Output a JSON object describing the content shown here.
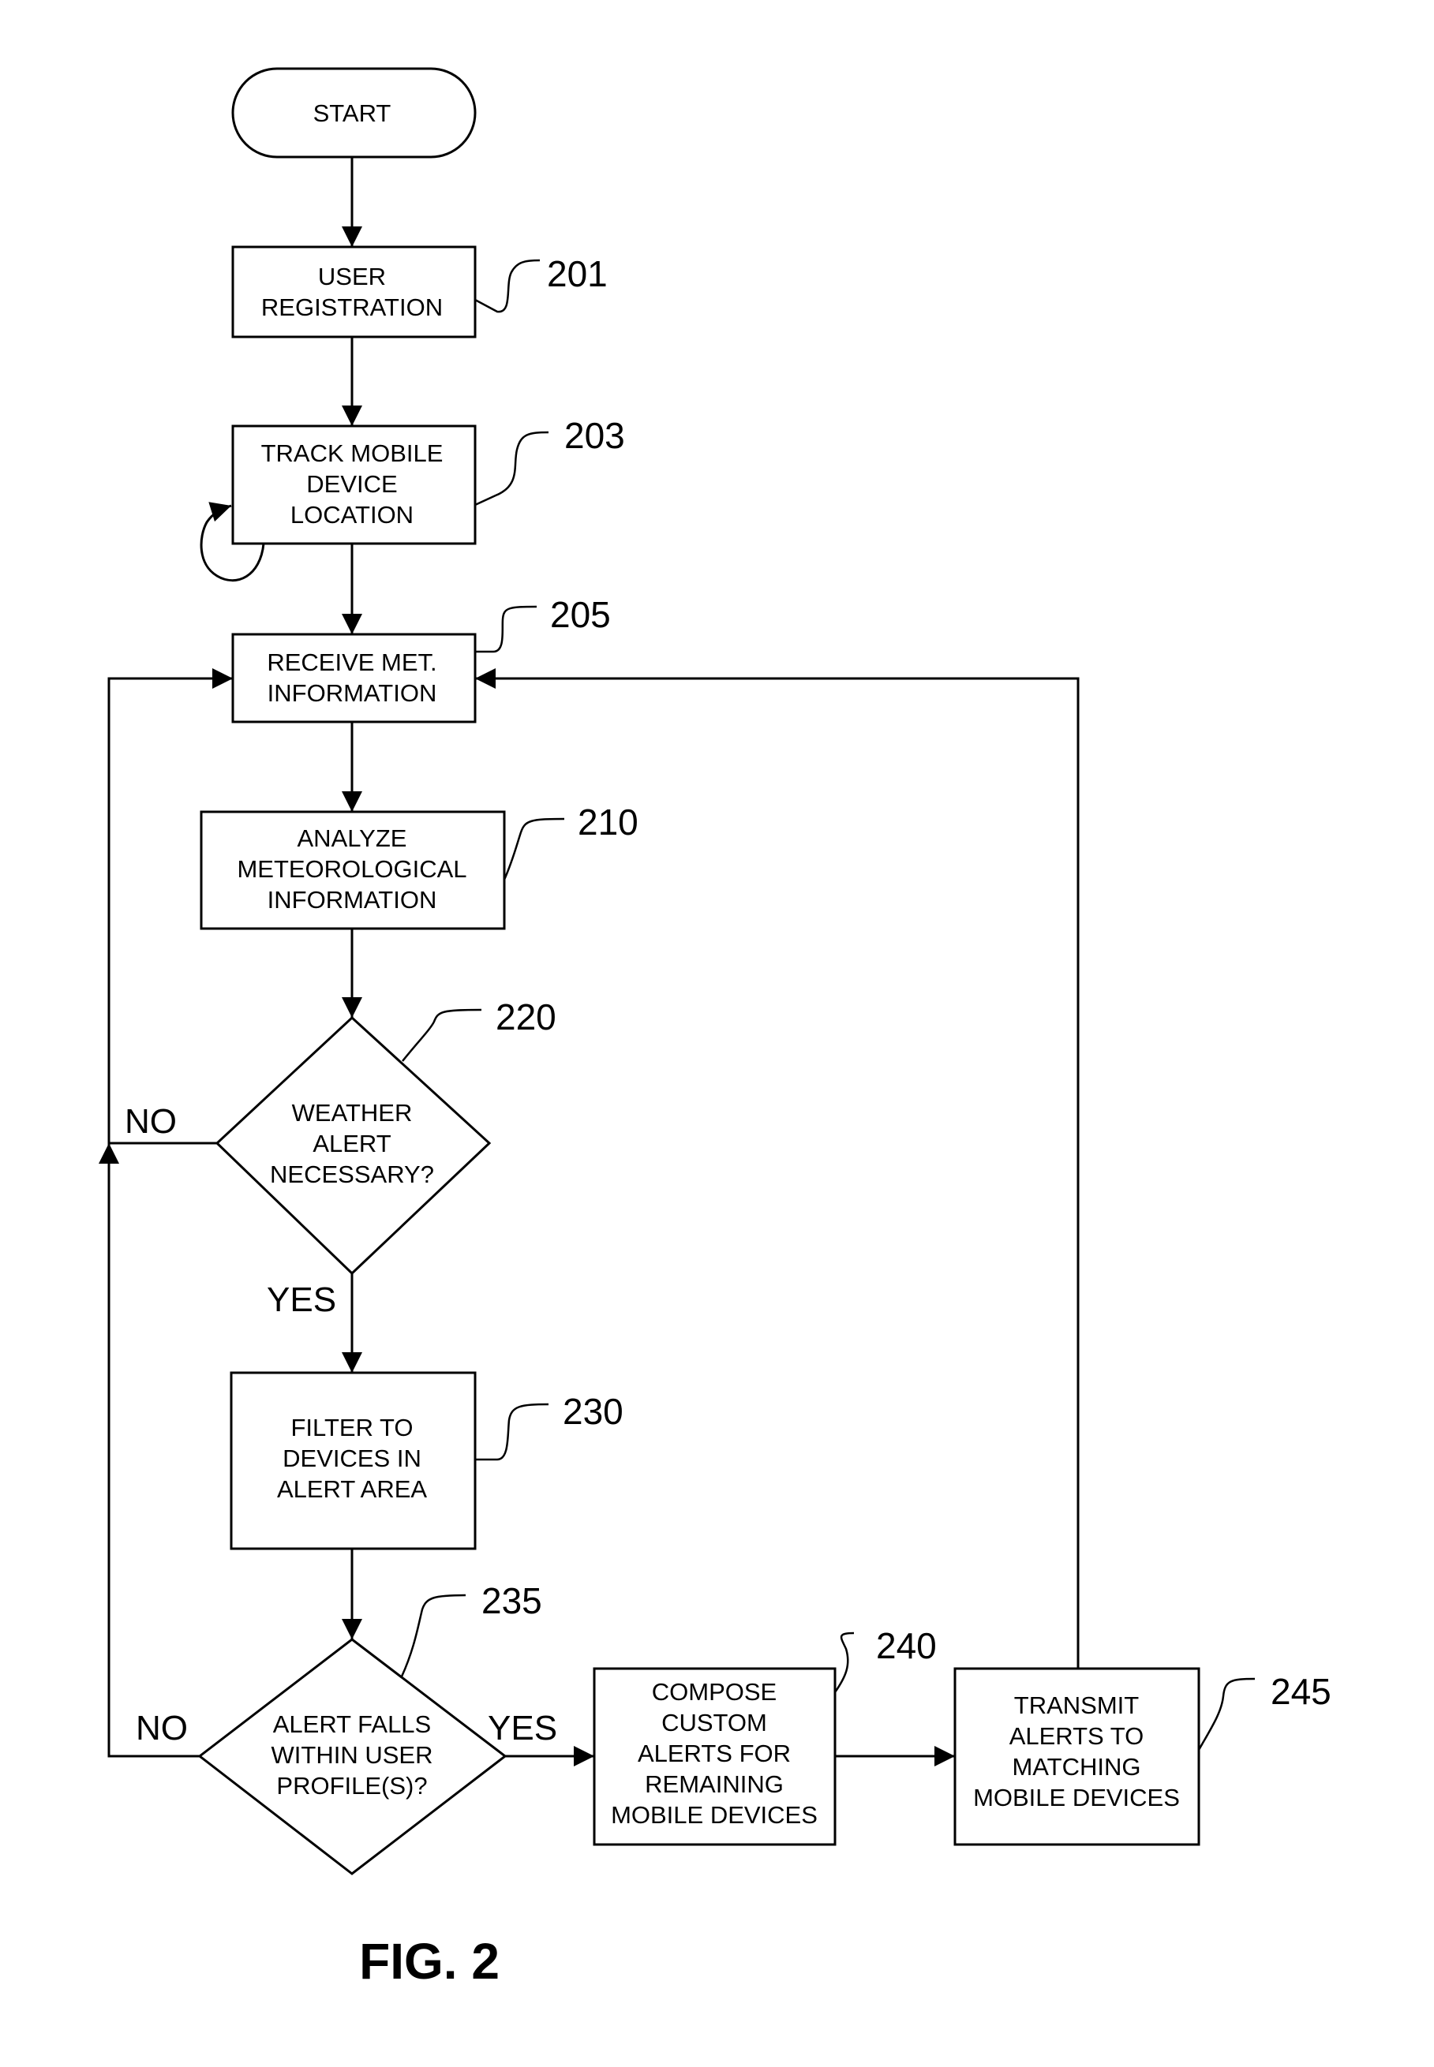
{
  "figure_label": "FIG. 2",
  "nodes": {
    "start": {
      "lines": [
        "START"
      ]
    },
    "n201": {
      "ref": "201",
      "lines": [
        "USER",
        "REGISTRATION"
      ]
    },
    "n203": {
      "ref": "203",
      "lines": [
        "TRACK MOBILE",
        "DEVICE",
        "LOCATION"
      ]
    },
    "n205": {
      "ref": "205",
      "lines": [
        "RECEIVE MET.",
        "INFORMATION"
      ]
    },
    "n210": {
      "ref": "210",
      "lines": [
        "ANALYZE",
        "METEOROLOGICAL",
        "INFORMATION"
      ]
    },
    "n220": {
      "ref": "220",
      "lines": [
        "WEATHER",
        "ALERT",
        "NECESSARY?"
      ],
      "no_label": "NO",
      "yes_label": "YES"
    },
    "n230": {
      "ref": "230",
      "lines": [
        "FILTER TO",
        "DEVICES IN",
        "ALERT AREA"
      ]
    },
    "n235": {
      "ref": "235",
      "lines": [
        "ALERT FALLS",
        "WITHIN USER",
        "PROFILE(S)?"
      ],
      "no_label": "NO",
      "yes_label": "YES"
    },
    "n240": {
      "ref": "240",
      "lines": [
        "COMPOSE",
        "CUSTOM",
        "ALERTS FOR",
        "REMAINING",
        "MOBILE DEVICES"
      ]
    },
    "n245": {
      "ref": "245",
      "lines": [
        "TRANSMIT",
        "ALERTS TO",
        "MATCHING",
        "MOBILE DEVICES"
      ]
    }
  }
}
